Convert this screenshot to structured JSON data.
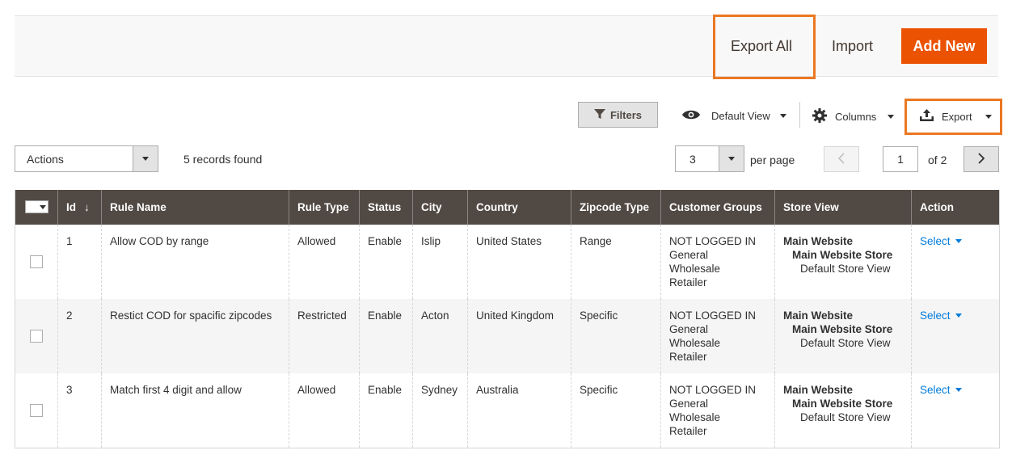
{
  "page_actions": {
    "export_all": "Export All",
    "import": "Import",
    "add_new": "Add New"
  },
  "toolbar": {
    "filters": "Filters",
    "view": "Default View",
    "columns": "Columns",
    "export": "Export"
  },
  "mass_actions": {
    "label": "Actions"
  },
  "records_found": "5 records found",
  "pager": {
    "per_page_value": "3",
    "per_page_label": "per page",
    "current_page": "1",
    "of_pages": "of 2"
  },
  "columns": [
    "Id",
    "Rule Name",
    "Rule Type",
    "Status",
    "City",
    "Country",
    "Zipcode Type",
    "Customer Groups",
    "Store View",
    "Action"
  ],
  "rows": [
    {
      "id": "1",
      "rule_name": "Allow COD by range",
      "rule_type": "Allowed",
      "status": "Enable",
      "city": "Islip",
      "country": "United States",
      "zipcode_type": "Range",
      "groups": [
        "NOT LOGGED IN",
        "General",
        "Wholesale",
        "Retailer"
      ],
      "store": [
        "Main Website",
        "Main Website Store",
        "Default Store View"
      ],
      "action": "Select"
    },
    {
      "id": "2",
      "rule_name": "Restict COD for spacific zipcodes",
      "rule_type": "Restricted",
      "status": "Enable",
      "city": "Acton",
      "country": "United Kingdom",
      "zipcode_type": "Specific",
      "groups": [
        "NOT LOGGED IN",
        "General",
        "Wholesale",
        "Retailer"
      ],
      "store": [
        "Main Website",
        "Main Website Store",
        "Default Store View"
      ],
      "action": "Select"
    },
    {
      "id": "3",
      "rule_name": "Match first 4 digit and allow",
      "rule_type": "Allowed",
      "status": "Enable",
      "city": "Sydney",
      "country": "Australia",
      "zipcode_type": "Specific",
      "groups": [
        "NOT LOGGED IN",
        "General",
        "Wholesale",
        "Retailer"
      ],
      "store": [
        "Main Website",
        "Main Website Store",
        "Default Store View"
      ],
      "action": "Select"
    }
  ],
  "colors": {
    "primary": "#eb5202",
    "highlight": "#eb7721",
    "header_bg": "#514943",
    "link": "#007bdb"
  }
}
